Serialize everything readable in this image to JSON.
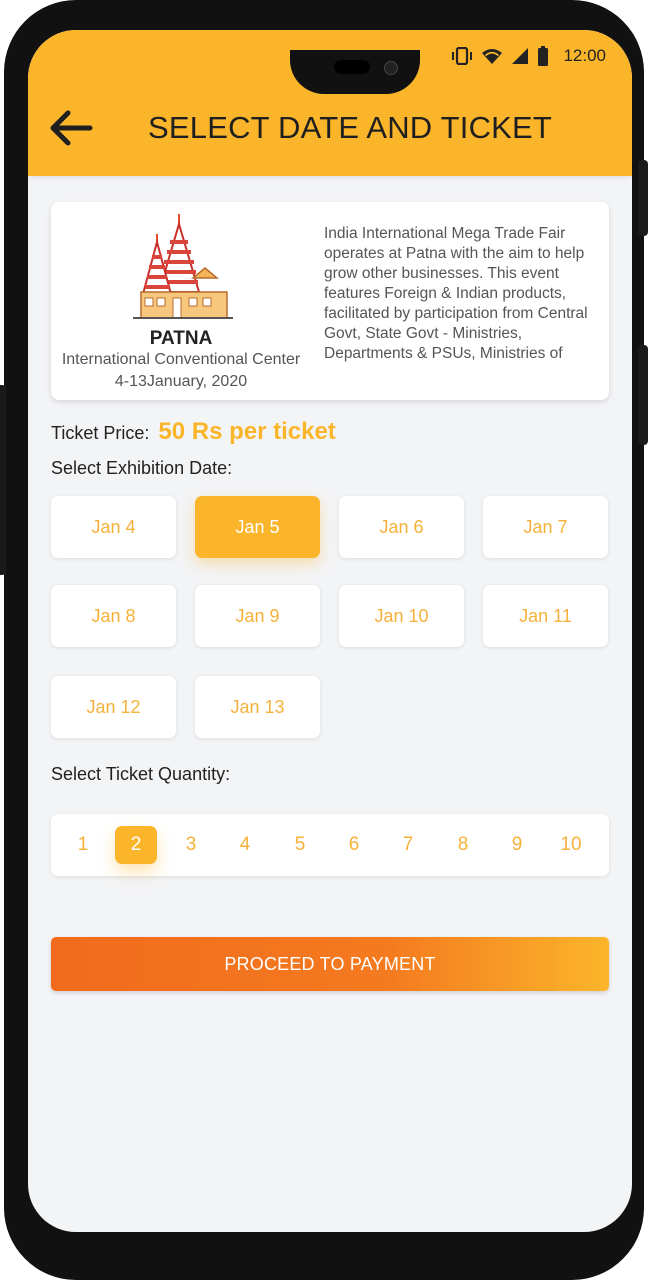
{
  "status": {
    "time": "12:00"
  },
  "header": {
    "title": "SELECT DATE AND TICKET"
  },
  "event": {
    "city": "PATNA",
    "venue": "International Conventional Center",
    "dates": "4-13January, 2020",
    "description": "India International Mega Trade Fair operates at Patna with the aim to help grow other businesses. This event features Foreign & Indian products, facilitated by participation from Central Govt, State Govt - Ministries, Departments & PSUs, Ministries of"
  },
  "ticket": {
    "price_label": "Ticket Price:",
    "price_value": "50 Rs per ticket"
  },
  "date_section": {
    "label": "Select Exhibition Date:",
    "dates": [
      "Jan 4",
      "Jan 5",
      "Jan 6",
      "Jan 7",
      "Jan 8",
      "Jan 9",
      "Jan 10",
      "Jan 11",
      "Jan 12",
      "Jan 13"
    ],
    "selected": "Jan 5"
  },
  "quantity_section": {
    "label": "Select Ticket Quantity:",
    "options": [
      "1",
      "2",
      "3",
      "4",
      "5",
      "6",
      "7",
      "8",
      "9",
      "10"
    ],
    "selected": "2"
  },
  "proceed_label": "PROCEED TO PAYMENT",
  "colors": {
    "accent": "#fbb52b",
    "button_start": "#f26b1d",
    "background": "#f3f4f6"
  },
  "icons": [
    "back-arrow-icon",
    "vibrate-icon",
    "wifi-icon",
    "signal-icon",
    "battery-icon",
    "temple-logo-icon"
  ]
}
